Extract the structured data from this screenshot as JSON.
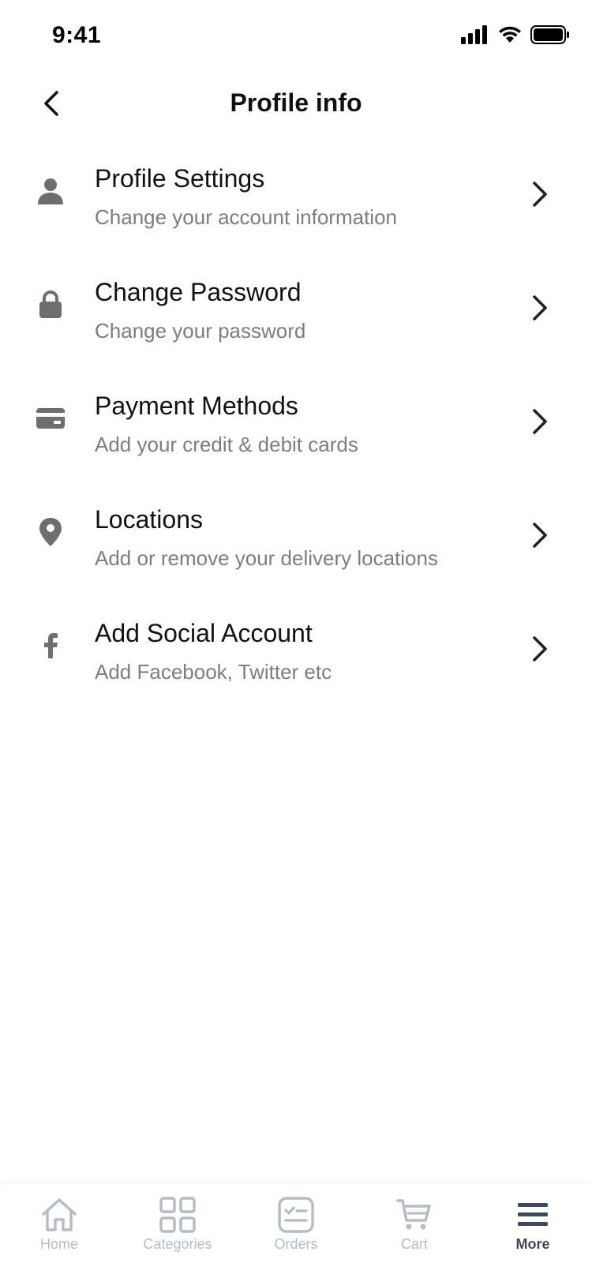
{
  "status_bar": {
    "time": "9:41"
  },
  "header": {
    "title": "Profile info",
    "back_icon": "chevron-left-icon"
  },
  "menu": [
    {
      "icon": "person-icon",
      "title": "Profile Settings",
      "subtitle": "Change your account information"
    },
    {
      "icon": "lock-icon",
      "title": "Change Password",
      "subtitle": "Change your password"
    },
    {
      "icon": "credit-card-icon",
      "title": "Payment Methods",
      "subtitle": "Add your credit & debit cards"
    },
    {
      "icon": "location-pin-icon",
      "title": "Locations",
      "subtitle": "Add or remove your delivery locations"
    },
    {
      "icon": "facebook-icon",
      "title": "Add Social Account",
      "subtitle": "Add Facebook, Twitter etc"
    }
  ],
  "bottom_nav": {
    "items": [
      {
        "label": "Home",
        "icon": "home-icon",
        "active": false
      },
      {
        "label": "Categories",
        "icon": "grid-icon",
        "active": false
      },
      {
        "label": "Orders",
        "icon": "orders-icon",
        "active": false
      },
      {
        "label": "Cart",
        "icon": "cart-icon",
        "active": false
      },
      {
        "label": "More",
        "icon": "menu-icon",
        "active": true
      }
    ]
  },
  "colors": {
    "title_text": "#111111",
    "subtitle_text": "#7d7d7d",
    "icon_gray": "#6e6e6e",
    "chevron": "#222222",
    "nav_inactive": "#b5bcc4",
    "nav_active": "#3d4a5c"
  }
}
